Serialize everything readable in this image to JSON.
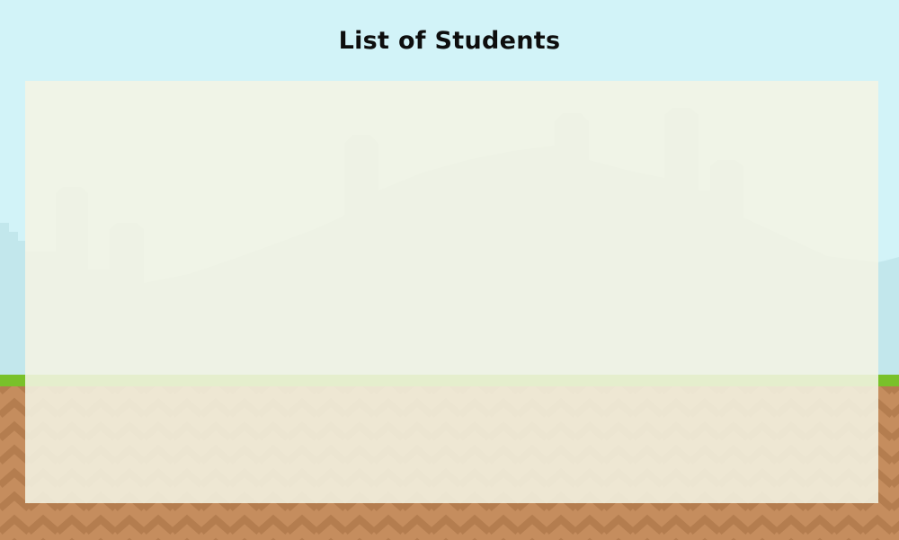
{
  "screen": {
    "title": "List of Students"
  },
  "students": [],
  "colors": {
    "sky": "#d2f3f8",
    "hills": "#c2e7ec",
    "grass": "#79c12a",
    "dirt": "#c58d5e",
    "dirt_dark": "#b07a4d",
    "panel": "#eef3e6"
  },
  "icons": {
    "background": "pixel-landscape",
    "terrain": "zigzag-dirt-pattern"
  }
}
